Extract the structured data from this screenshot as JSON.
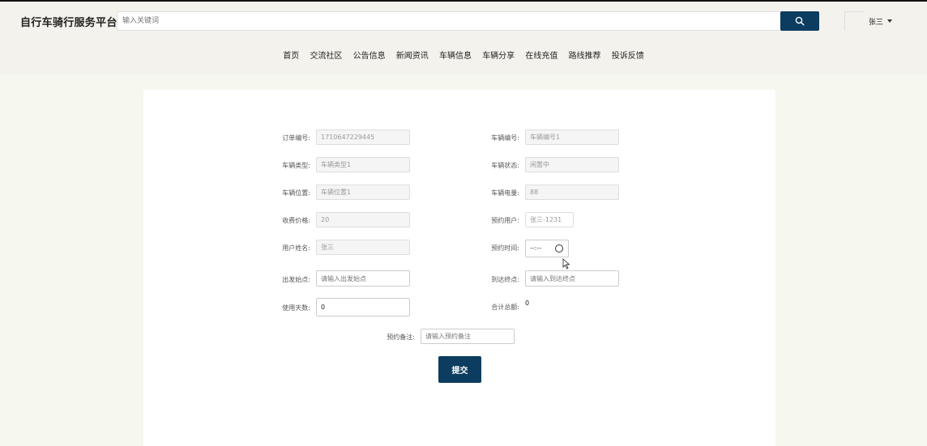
{
  "app_title": "自行车骑行服务平台",
  "search": {
    "placeholder": "输入关键词"
  },
  "user": {
    "name": "张三"
  },
  "nav": [
    "首页",
    "交流社区",
    "公告信息",
    "新闻资讯",
    "车辆信息",
    "车辆分享",
    "在线充值",
    "路线推荐",
    "投诉反馈"
  ],
  "form": {
    "order_no": {
      "label": "订单编号:",
      "value": "1710647229445"
    },
    "vehicle_no": {
      "label": "车辆编号:",
      "value": "车辆编号1"
    },
    "vehicle_type": {
      "label": "车辆类型:",
      "value": "车辆类型1"
    },
    "vehicle_status": {
      "label": "车辆状态:",
      "value": "闲置中"
    },
    "vehicle_location": {
      "label": "车辆位置:",
      "value": "车辆位置1"
    },
    "vehicle_battery": {
      "label": "车辆电量:",
      "value": "88"
    },
    "price": {
      "label": "收费价格:",
      "value": "20"
    },
    "booking_user": {
      "label": "预约用户:",
      "value": "张三-1231"
    },
    "user_name": {
      "label": "用户姓名:",
      "value": "张三"
    },
    "booking_time": {
      "label": "预约时间:",
      "value": "--:--"
    },
    "start_point": {
      "label": "出发始点:",
      "placeholder": "请输入出发始点"
    },
    "end_point": {
      "label": "到达终点:",
      "placeholder": "请输入到达终点"
    },
    "days": {
      "label": "使用天数:",
      "value": "0"
    },
    "total": {
      "label": "合计总额:",
      "value": "0"
    },
    "remark": {
      "label": "预约备注:",
      "placeholder": "请输入预约备注"
    },
    "submit_label": "提交"
  },
  "colors": {
    "primary": "#0c3c60",
    "header_bg": "#f4f2ec",
    "page_bg": "#f6f7ef"
  }
}
